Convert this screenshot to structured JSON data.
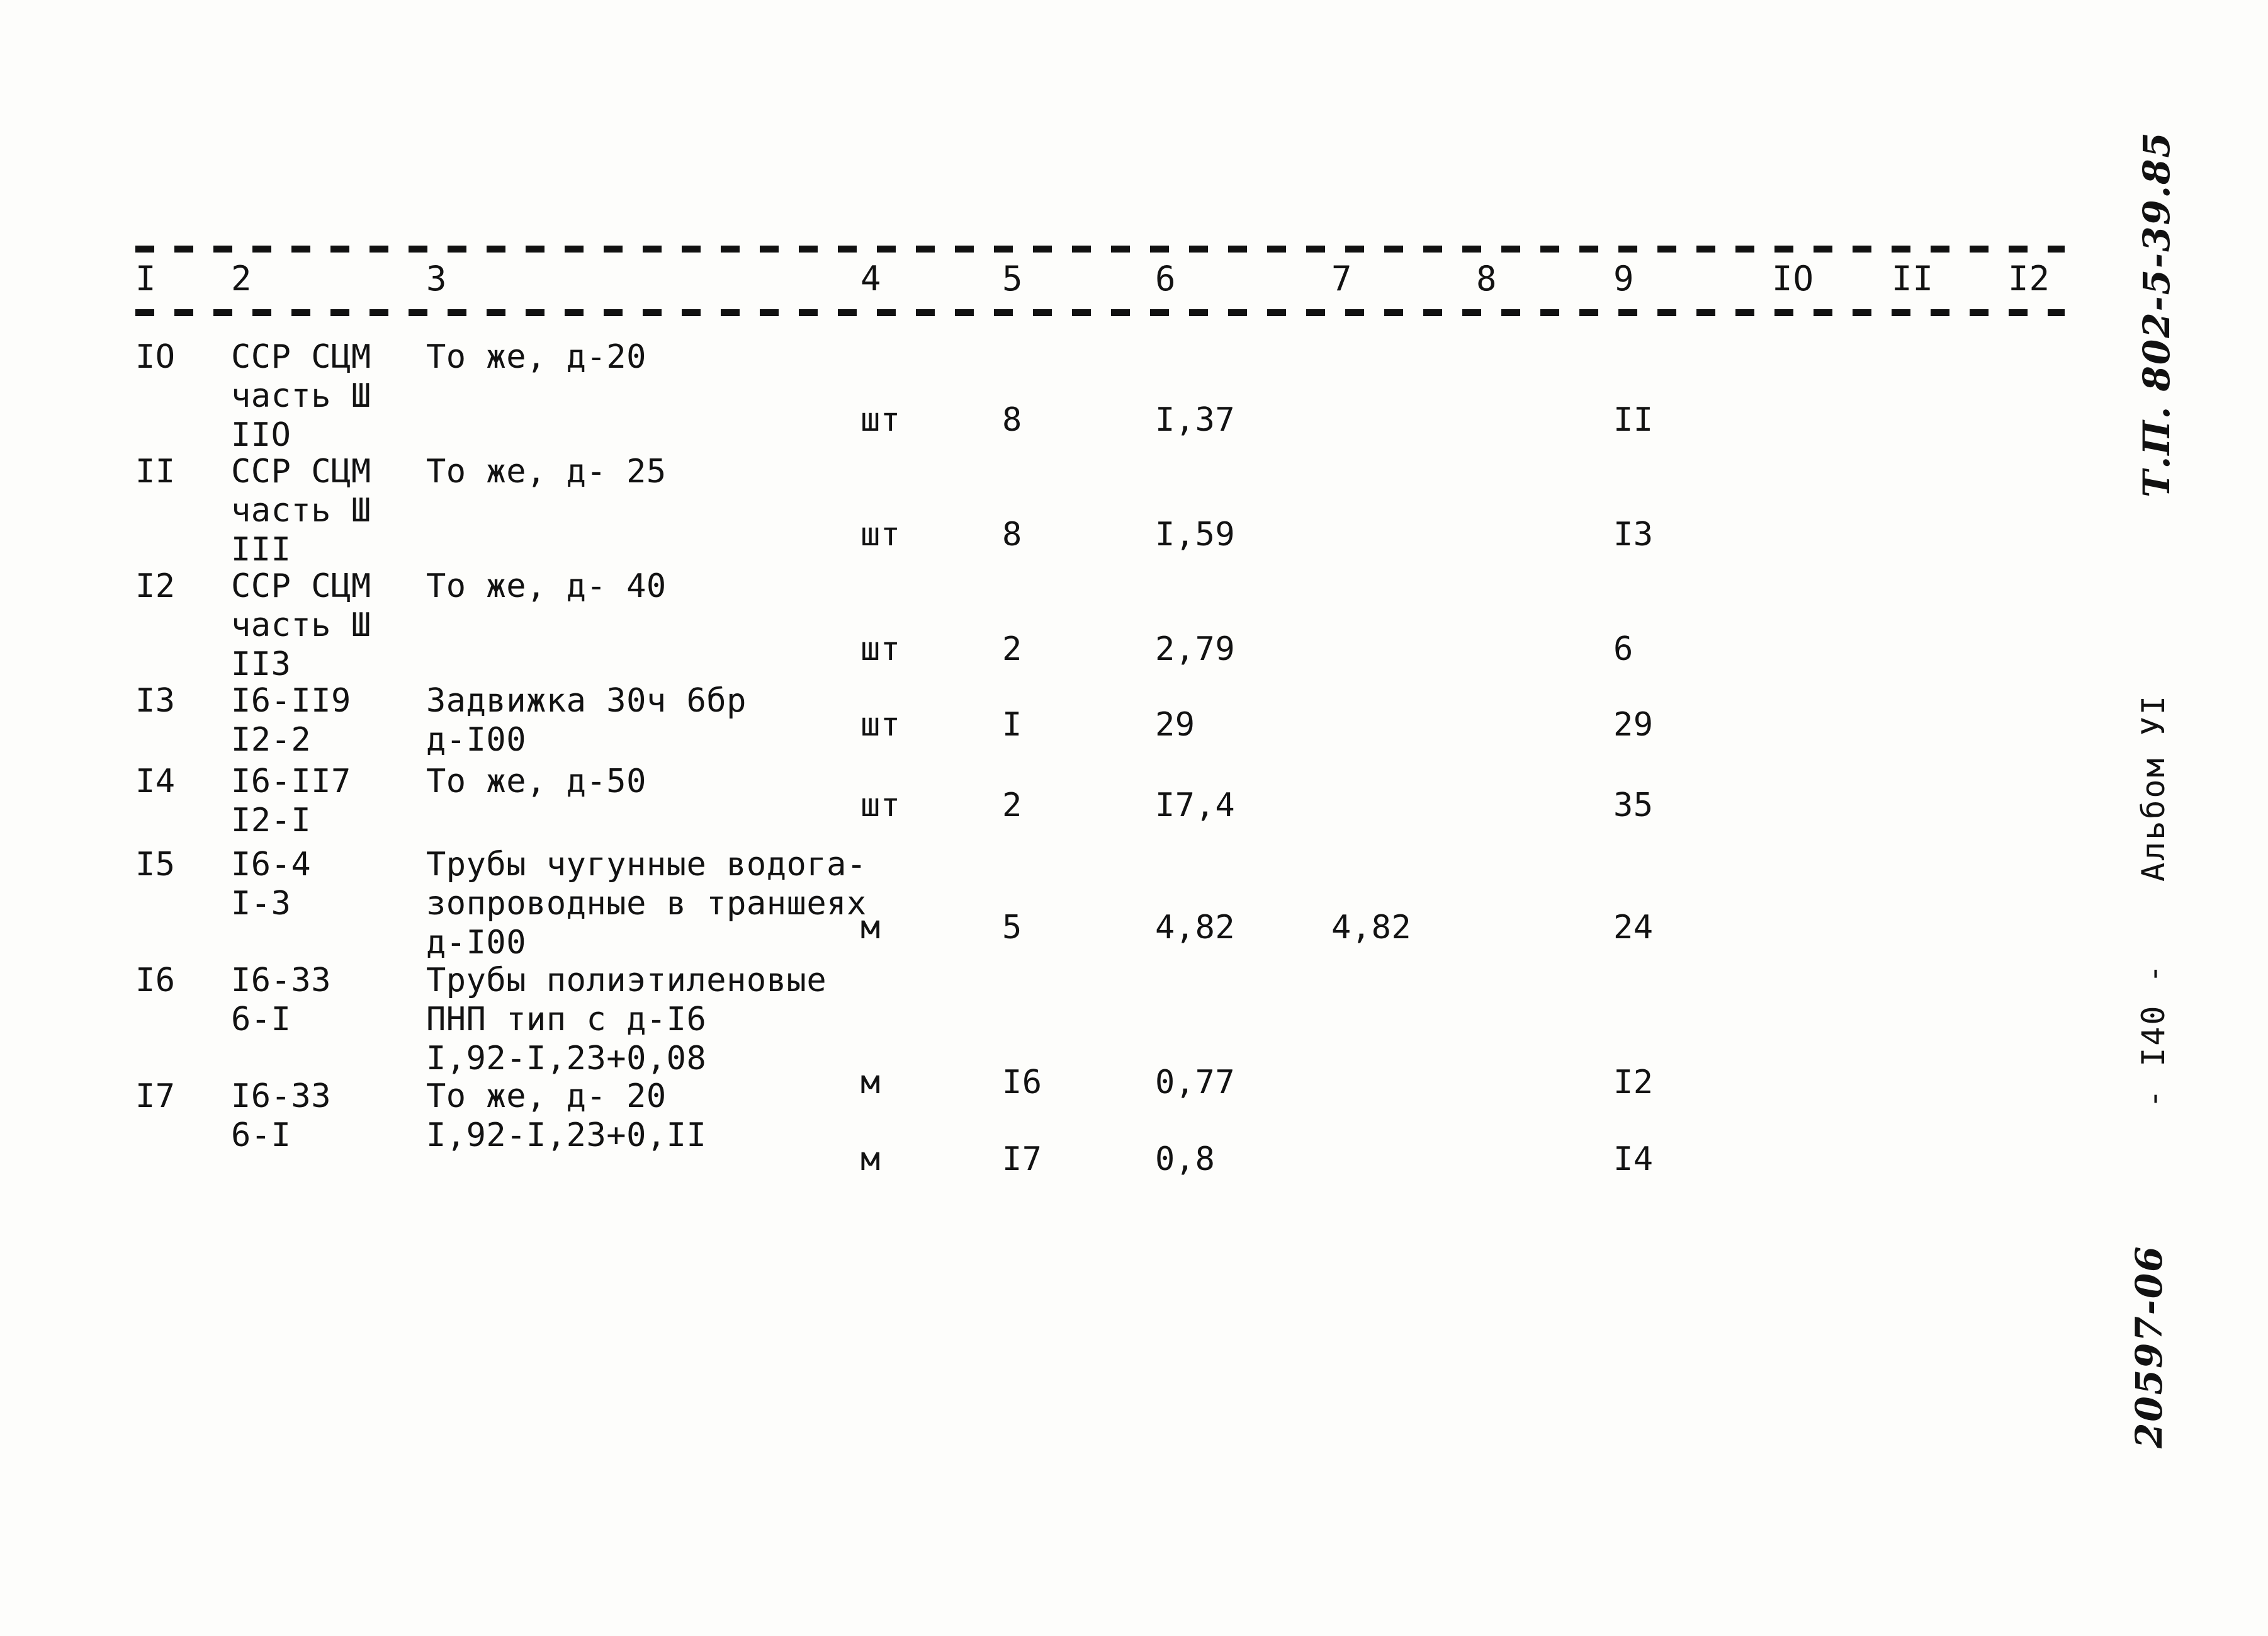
{
  "table": {
    "column_headers": [
      "I",
      "2",
      "3",
      "4",
      "5",
      "6",
      "7",
      "8",
      "9",
      "IO",
      "II",
      "I2"
    ],
    "rows": [
      {
        "num": "IO",
        "code_l1": "ССР СЦМ",
        "code_l2": "часть Ш",
        "code_l3": "IIO",
        "desc_l1": "То же, д-20",
        "desc_l2": "",
        "desc_l3": "",
        "unit": "шт",
        "qty": "8",
        "col6": "I,37",
        "col7": "",
        "col8": "",
        "col9": "II"
      },
      {
        "num": "II",
        "code_l1": "ССР СЦМ",
        "code_l2": "часть Ш",
        "code_l3": "III",
        "desc_l1": "То же, д- 25",
        "desc_l2": "",
        "desc_l3": "",
        "unit": "шт",
        "qty": "8",
        "col6": "I,59",
        "col7": "",
        "col8": "",
        "col9": "I3"
      },
      {
        "num": "I2",
        "code_l1": "ССР СЦМ",
        "code_l2": "часть Ш",
        "code_l3": "II3",
        "desc_l1": "То же, д- 40",
        "desc_l2": "",
        "desc_l3": "",
        "unit": "шт",
        "qty": "2",
        "col6": "2,79",
        "col7": "",
        "col8": "",
        "col9": "6"
      },
      {
        "num": "I3",
        "code_l1": "I6-II9",
        "code_l2": "I2-2",
        "code_l3": "",
        "desc_l1": "Задвижка 30ч 6бр",
        "desc_l2": "д-I00",
        "desc_l3": "",
        "unit": "шт",
        "qty": "I",
        "col6": "29",
        "col7": "",
        "col8": "",
        "col9": "29"
      },
      {
        "num": "I4",
        "code_l1": "I6-II7",
        "code_l2": "I2-I",
        "code_l3": "",
        "desc_l1": "То же, д-50",
        "desc_l2": "",
        "desc_l3": "",
        "unit": "шт",
        "qty": "2",
        "col6": "I7,4",
        "col7": "",
        "col8": "",
        "col9": "35"
      },
      {
        "num": "I5",
        "code_l1": "I6-4",
        "code_l2": "I-3",
        "code_l3": "",
        "desc_l1": "Трубы чугунные водога-",
        "desc_l2": "зопроводные в траншеях",
        "desc_l3": "д-I00",
        "unit": "м",
        "qty": "5",
        "col6": "4,82",
        "col7": "4,82",
        "col8": "",
        "col9": "24"
      },
      {
        "num": "I6",
        "code_l1": "I6-33",
        "code_l2": "6-I",
        "code_l3": "",
        "desc_l1": "Трубы полиэтиленовые",
        "desc_l2": "ПНП тип с д-I6",
        "desc_l3": "I,92-I,23+0,08",
        "unit": "м",
        "qty": "I6",
        "col6": "0,77",
        "col7": "",
        "col8": "",
        "col9": "I2"
      },
      {
        "num": "I7",
        "code_l1": "I6-33",
        "code_l2": "6-I",
        "code_l3": "",
        "desc_l1": "То же, д- 20",
        "desc_l2": "",
        "desc_l3": "I,92-I,23+0,II",
        "unit": "м",
        "qty": "I7",
        "col6": "0,8",
        "col7": "",
        "col8": "",
        "col9": "I4"
      }
    ]
  },
  "margin": {
    "doc_code": "Т.П. 802-5-39.85",
    "album_label": "Альбом УI",
    "page_number": "- I40 -",
    "archive_code": "20597-06"
  }
}
